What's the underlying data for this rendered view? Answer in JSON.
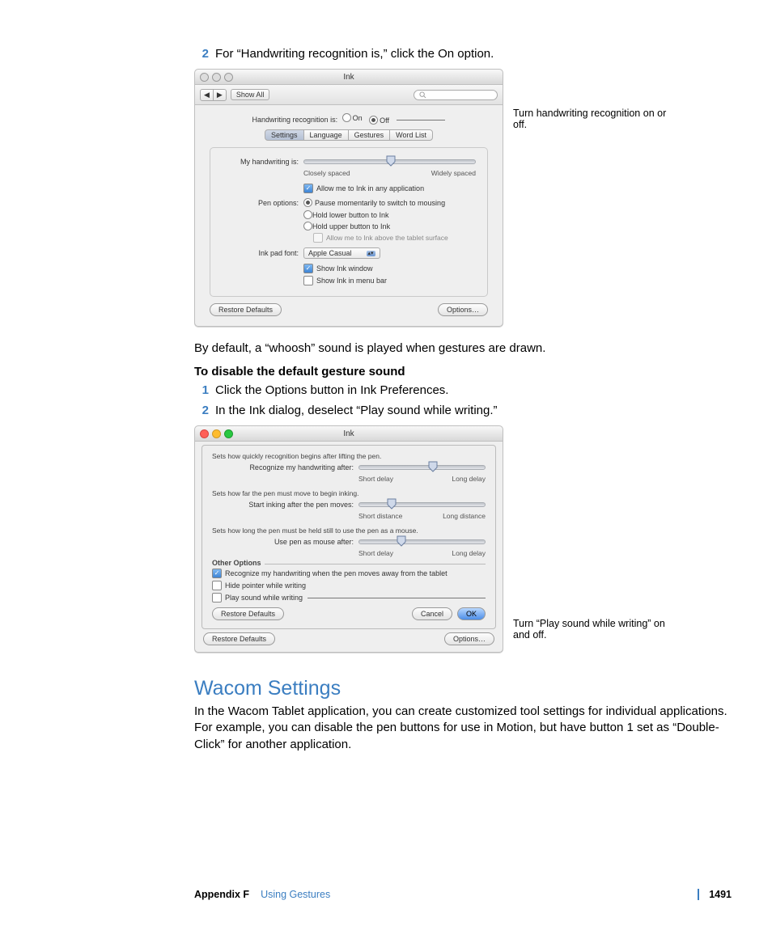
{
  "steps_a": {
    "num": "2",
    "text": "For “Handwriting recognition is,” click the On option."
  },
  "annot1": "Turn handwriting recognition on or off.",
  "win1": {
    "title": "Ink",
    "showall": "Show All",
    "recog_label": "Handwriting recognition is:",
    "on": "On",
    "off": "Off",
    "tabs": [
      "Settings",
      "Language",
      "Gestures",
      "Word List"
    ],
    "handwriting_label": "My handwriting is:",
    "closely": "Closely spaced",
    "widely": "Widely spaced",
    "allow_any": "Allow me to Ink in any application",
    "penopt_label": "Pen options:",
    "opt1": "Pause momentarily to switch to mousing",
    "opt2": "Hold lower button to Ink",
    "opt3": "Hold upper button to Ink",
    "opt4": "Allow me to Ink above the tablet surface",
    "font_label": "Ink pad font:",
    "font_value": "Apple Casual",
    "show_window": "Show Ink window",
    "show_menubar": "Show Ink in menu bar",
    "restore": "Restore Defaults",
    "options": "Options…"
  },
  "body1": "By default, a “whoosh” sound is played when gestures are drawn.",
  "subhead": "To disable the default gesture sound",
  "steps_b": [
    {
      "num": "1",
      "text": "Click the Options button in Ink Preferences."
    },
    {
      "num": "2",
      "text": "In the Ink dialog, deselect “Play sound while writing.”"
    }
  ],
  "win2": {
    "title": "Ink",
    "d1": "Sets how quickly recognition begins after lifting the pen.",
    "l1": "Recognize my handwriting after:",
    "s1a": "Short delay",
    "s1b": "Long delay",
    "d2": "Sets how far the pen must move to begin inking.",
    "l2": "Start inking after the pen moves:",
    "s2a": "Short distance",
    "s2b": "Long distance",
    "d3": "Sets how long the pen must be held still to use the pen as a mouse.",
    "l3": "Use pen as mouse after:",
    "s3a": "Short delay",
    "s3b": "Long delay",
    "other": "Other Options",
    "c1": "Recognize my handwriting when the pen moves away from the tablet",
    "c2": "Hide pointer while writing",
    "c3": "Play sound while writing",
    "restore": "Restore Defaults",
    "cancel": "Cancel",
    "ok": "OK",
    "under_restore": "Restore Defaults",
    "under_options": "Options…"
  },
  "annot2": "Turn “Play sound while writing” on and off.",
  "section": "Wacom Settings",
  "section_body": "In the Wacom Tablet application, you can create customized tool settings for individual applications. For example, you can disable the pen buttons for use in Motion, but have button 1 set as “Double-Click” for another application.",
  "footer": {
    "appendix": "Appendix F",
    "chapter": "Using Gestures",
    "page": "1491"
  }
}
